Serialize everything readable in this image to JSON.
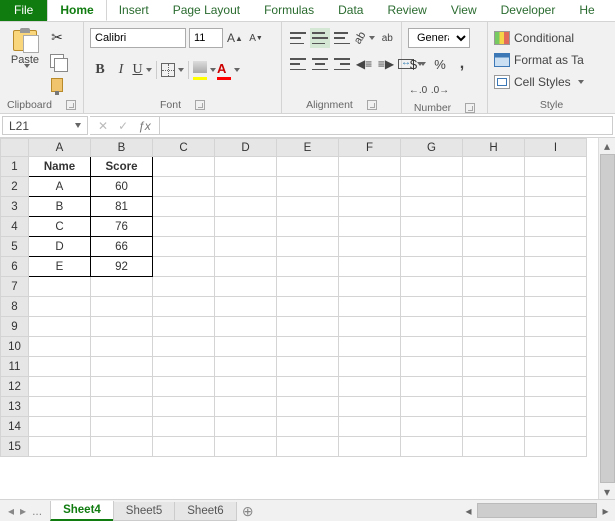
{
  "menu_tabs": {
    "file": "File",
    "home": "Home",
    "insert": "Insert",
    "page_layout": "Page Layout",
    "formulas": "Formulas",
    "data": "Data",
    "review": "Review",
    "view": "View",
    "developer": "Developer",
    "help": "He"
  },
  "ribbon": {
    "clipboard": {
      "label": "Clipboard",
      "paste": "Paste"
    },
    "font": {
      "label": "Font",
      "name": "Calibri",
      "size": "11",
      "B": "B",
      "I": "I",
      "U": "U",
      "A": "A"
    },
    "alignment": {
      "label": "Alignment",
      "ab": "ab"
    },
    "number": {
      "label": "Number",
      "format": "General",
      "dollar": "$",
      "percent": "%",
      "comma": ",",
      "dec_inc": ".0 .00",
      "dec_dec": ".00 .0"
    },
    "styles": {
      "label": "Style",
      "conditional": "Conditional",
      "format_table": "Format as Ta",
      "cell_styles": "Cell Styles"
    }
  },
  "name_box": "L21",
  "formula": "",
  "columns": [
    "A",
    "B",
    "C",
    "D",
    "E",
    "F",
    "G",
    "H",
    "I"
  ],
  "rows": [
    "1",
    "2",
    "3",
    "4",
    "5",
    "6",
    "7",
    "8",
    "9",
    "10",
    "11",
    "12",
    "13",
    "14",
    "15"
  ],
  "cells": {
    "A1": "Name",
    "B1": "Score",
    "A2": "A",
    "B2": "60",
    "A3": "B",
    "B3": "81",
    "A4": "C",
    "B4": "76",
    "A5": "D",
    "B5": "66",
    "A6": "E",
    "B6": "92"
  },
  "sheet_tabs": {
    "ellipsis": "...",
    "s4": "Sheet4",
    "s5": "Sheet5",
    "s6": "Sheet6"
  },
  "chart_data": {
    "type": "table",
    "columns": [
      "Name",
      "Score"
    ],
    "rows": [
      [
        "A",
        60
      ],
      [
        "B",
        81
      ],
      [
        "C",
        76
      ],
      [
        "D",
        66
      ],
      [
        "E",
        92
      ]
    ]
  }
}
